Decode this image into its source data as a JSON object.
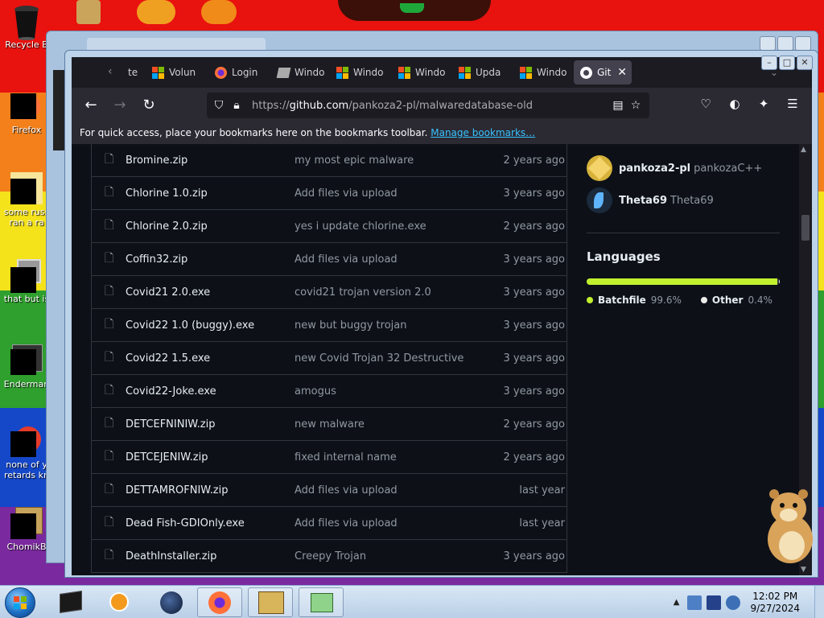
{
  "desktop": {
    "icons": [
      {
        "label": "Recycle B",
        "icon": "recycle-bin-icon"
      },
      {
        "label": "Firefox",
        "icon": "firefox-icon"
      },
      {
        "label": "some russ ran a ra",
        "icon": "shortcut-icon"
      },
      {
        "label": "that but is",
        "icon": "shortcut-icon"
      },
      {
        "label": "Enderman",
        "icon": "shortcut-icon"
      },
      {
        "label": "none of y retards kn",
        "icon": "shortcut-icon"
      },
      {
        "label": "ChomikB",
        "icon": "hamster-icon"
      }
    ]
  },
  "browser": {
    "tabs": [
      {
        "label": "te",
        "icon": "tab-icon"
      },
      {
        "label": "Volun",
        "icon": "windows-logo-icon"
      },
      {
        "label": "Login",
        "icon": "firefox-icon"
      },
      {
        "label": "Windo",
        "icon": "windows-icon"
      },
      {
        "label": "Windo",
        "icon": "windows-logo-icon"
      },
      {
        "label": "Windo",
        "icon": "windows-logo-icon"
      },
      {
        "label": "Upda",
        "icon": "windows-logo-icon"
      },
      {
        "label": "Windo",
        "icon": "windows-logo-icon"
      },
      {
        "label": "Git",
        "icon": "github-icon",
        "active": true
      }
    ],
    "url": {
      "scheme": "https://",
      "host": "github.com",
      "path": "/pankoza2-pl/malwaredatabase-old"
    },
    "bookmarks_text": "For quick access, place your bookmarks here on the bookmarks toolbar.",
    "bookmarks_link": "Manage bookmarks…"
  },
  "files": [
    {
      "name": "Bromine.zip",
      "message": "my most epic malware",
      "when": "2 years ago"
    },
    {
      "name": "Chlorine 1.0.zip",
      "message": "Add files via upload",
      "when": "3 years ago"
    },
    {
      "name": "Chlorine 2.0.zip",
      "message": "yes i update chlorine.exe",
      "when": "2 years ago"
    },
    {
      "name": "Coffin32.zip",
      "message": "Add files via upload",
      "when": "3 years ago"
    },
    {
      "name": "Covid21 2.0.exe",
      "message": "covid21 trojan version 2.0",
      "when": "3 years ago"
    },
    {
      "name": "Covid22 1.0 (buggy).exe",
      "message": "new but buggy trojan",
      "when": "3 years ago"
    },
    {
      "name": "Covid22 1.5.exe",
      "message": "new Covid Trojan 32 Destructive",
      "when": "3 years ago"
    },
    {
      "name": "Covid22-Joke.exe",
      "message": "amogus",
      "when": "3 years ago"
    },
    {
      "name": "DETCEFNINIW.zip",
      "message": "new malware",
      "when": "2 years ago"
    },
    {
      "name": "DETCEJENIW.zip",
      "message": "fixed internal name",
      "when": "2 years ago"
    },
    {
      "name": "DETTAMROFNIW.zip",
      "message": "Add files via upload",
      "when": "last year"
    },
    {
      "name": "Dead Fish-GDIOnly.exe",
      "message": "Add files via upload",
      "when": "last year"
    },
    {
      "name": "DeathInstaller.zip",
      "message": "Creepy Trojan",
      "when": "3 years ago"
    }
  ],
  "contributors": [
    {
      "name": "pankoza2-pl",
      "handle": "pankozaC++"
    },
    {
      "name": "Theta69",
      "handle": "Theta69"
    }
  ],
  "languages": {
    "heading": "Languages",
    "items": [
      {
        "name": "Batchfile",
        "percent": "99.6%",
        "fraction": 0.996,
        "color": "#c1f12e"
      },
      {
        "name": "Other",
        "percent": "0.4%",
        "fraction": 0.004,
        "color": "#ededed"
      }
    ]
  },
  "taskbar": {
    "time": "12:02 PM",
    "date": "9/27/2024",
    "apps": [
      "terminal-icon",
      "media-player-icon",
      "globe-icon",
      "firefox-icon",
      "hamster-box-icon",
      "install-icon"
    ]
  },
  "colors": {
    "accent_link": "#37c2ff",
    "github_bg": "#0d1117",
    "batchfile": "#c1f12e"
  }
}
